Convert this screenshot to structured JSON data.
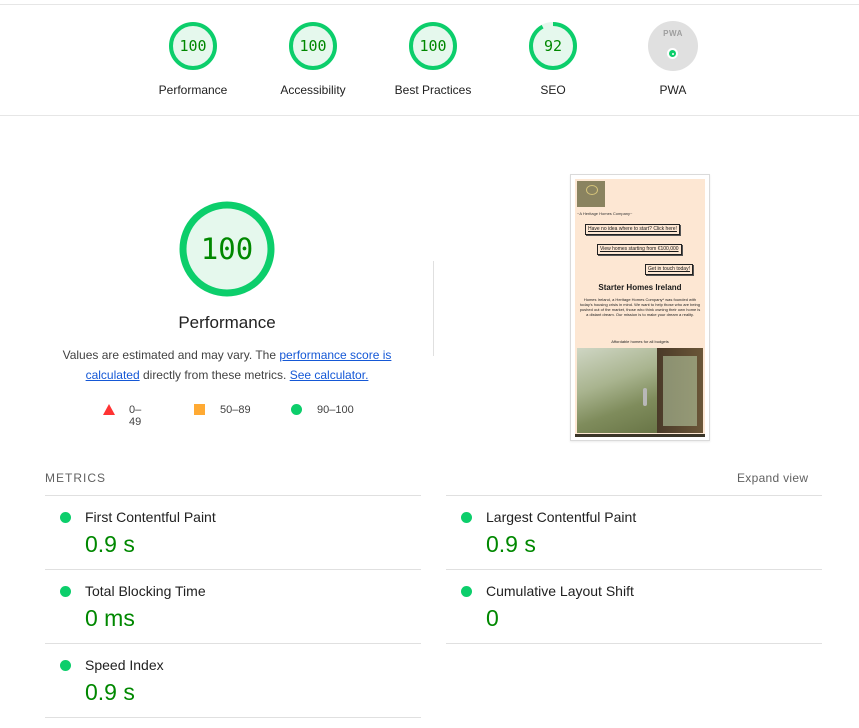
{
  "categories": [
    {
      "score": "100",
      "label": "Performance",
      "fraction": 1.0
    },
    {
      "score": "100",
      "label": "Accessibility",
      "fraction": 1.0
    },
    {
      "score": "100",
      "label": "Best Practices",
      "fraction": 1.0
    },
    {
      "score": "92",
      "label": "SEO",
      "fraction": 0.92
    }
  ],
  "pwa": {
    "badge_text": "PWA",
    "label": "PWA"
  },
  "performance": {
    "score": "100",
    "title": "Performance",
    "desc_prefix": "Values are estimated and may vary. The ",
    "desc_link1": "performance score is calculated",
    "desc_middle": " directly from these metrics. ",
    "desc_link2": "See calculator."
  },
  "legend": [
    {
      "range": "0–49",
      "shape": "triangle",
      "color": "#ff3333"
    },
    {
      "range": "50–89",
      "shape": "square",
      "color": "#ffaa33"
    },
    {
      "range": "90–100",
      "shape": "circle",
      "color": "#0cce6b"
    }
  ],
  "screenshot": {
    "tagline": "~A Heritage Homes Company~",
    "buttons": [
      "Have no idea where to start? Click here!",
      "View homes starting from €100,000",
      "Get in touch today!"
    ],
    "heading": "Starter Homes Ireland",
    "paragraph": "Homes Ireland, a Heritage Homes Company* was founded with today's housing crisis in mind. We want to help those who are being pushed out of the market, those who think owning their own home is a distant dream. Our mission is to make your dream a reality.",
    "affordable": "Affordable homes for all budgets"
  },
  "metrics": {
    "heading": "METRICS",
    "expand_label": "Expand view",
    "items": [
      {
        "label": "First Contentful Paint",
        "value": "0.9 s"
      },
      {
        "label": "Largest Contentful Paint",
        "value": "0.9 s"
      },
      {
        "label": "Total Blocking Time",
        "value": "0 ms"
      },
      {
        "label": "Cumulative Layout Shift",
        "value": "0"
      },
      {
        "label": "Speed Index",
        "value": "0.9 s"
      }
    ]
  },
  "colors": {
    "pass": "#0cce6b",
    "pass_text": "#008800",
    "gauge_bg": "#e5f8ed"
  }
}
